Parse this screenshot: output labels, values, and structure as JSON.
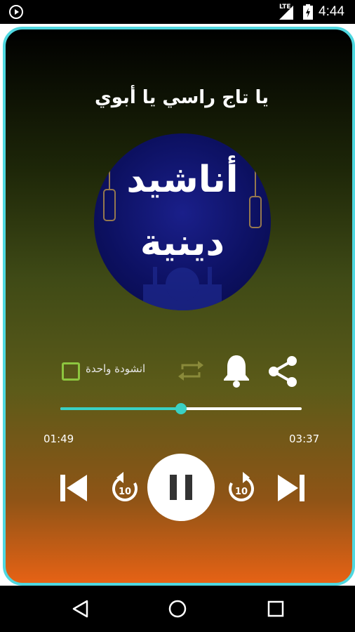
{
  "status_bar": {
    "time": "4:44",
    "network": "LTE"
  },
  "player": {
    "song_title": "يا تاج راسي يا أبوي",
    "album_line1": "أناشيد",
    "album_line2": "دينية",
    "single_track_label": "انشودة واحدة",
    "single_track_checked": false,
    "progress_fraction": 0.5,
    "elapsed": "01:49",
    "duration": "03:37",
    "skip_seconds": "10",
    "state": "playing"
  },
  "colors": {
    "border": "#4fd8e0",
    "seek_accent": "#3ad0c4",
    "checkbox": "#8dc63f",
    "repeat_icon": "#8a8a3a"
  },
  "icons": [
    "play-icon",
    "signal-icon",
    "battery-icon",
    "repeat-icon",
    "bell-icon",
    "share-icon",
    "skip-previous-icon",
    "rewind-10-icon",
    "pause-icon",
    "forward-10-icon",
    "skip-next-icon",
    "back-icon",
    "home-icon",
    "recents-icon"
  ]
}
